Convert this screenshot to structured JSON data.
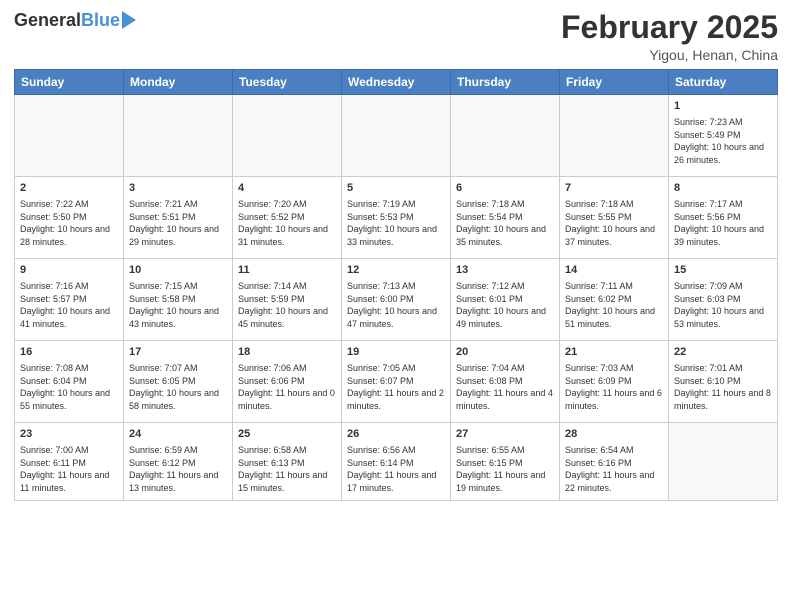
{
  "header": {
    "logo_general": "General",
    "logo_blue": "Blue",
    "month_title": "February 2025",
    "location": "Yigou, Henan, China"
  },
  "days_of_week": [
    "Sunday",
    "Monday",
    "Tuesday",
    "Wednesday",
    "Thursday",
    "Friday",
    "Saturday"
  ],
  "weeks": [
    [
      {
        "day": "",
        "info": ""
      },
      {
        "day": "",
        "info": ""
      },
      {
        "day": "",
        "info": ""
      },
      {
        "day": "",
        "info": ""
      },
      {
        "day": "",
        "info": ""
      },
      {
        "day": "",
        "info": ""
      },
      {
        "day": "1",
        "info": "Sunrise: 7:23 AM\nSunset: 5:49 PM\nDaylight: 10 hours and 26 minutes."
      }
    ],
    [
      {
        "day": "2",
        "info": "Sunrise: 7:22 AM\nSunset: 5:50 PM\nDaylight: 10 hours and 28 minutes."
      },
      {
        "day": "3",
        "info": "Sunrise: 7:21 AM\nSunset: 5:51 PM\nDaylight: 10 hours and 29 minutes."
      },
      {
        "day": "4",
        "info": "Sunrise: 7:20 AM\nSunset: 5:52 PM\nDaylight: 10 hours and 31 minutes."
      },
      {
        "day": "5",
        "info": "Sunrise: 7:19 AM\nSunset: 5:53 PM\nDaylight: 10 hours and 33 minutes."
      },
      {
        "day": "6",
        "info": "Sunrise: 7:18 AM\nSunset: 5:54 PM\nDaylight: 10 hours and 35 minutes."
      },
      {
        "day": "7",
        "info": "Sunrise: 7:18 AM\nSunset: 5:55 PM\nDaylight: 10 hours and 37 minutes."
      },
      {
        "day": "8",
        "info": "Sunrise: 7:17 AM\nSunset: 5:56 PM\nDaylight: 10 hours and 39 minutes."
      }
    ],
    [
      {
        "day": "9",
        "info": "Sunrise: 7:16 AM\nSunset: 5:57 PM\nDaylight: 10 hours and 41 minutes."
      },
      {
        "day": "10",
        "info": "Sunrise: 7:15 AM\nSunset: 5:58 PM\nDaylight: 10 hours and 43 minutes."
      },
      {
        "day": "11",
        "info": "Sunrise: 7:14 AM\nSunset: 5:59 PM\nDaylight: 10 hours and 45 minutes."
      },
      {
        "day": "12",
        "info": "Sunrise: 7:13 AM\nSunset: 6:00 PM\nDaylight: 10 hours and 47 minutes."
      },
      {
        "day": "13",
        "info": "Sunrise: 7:12 AM\nSunset: 6:01 PM\nDaylight: 10 hours and 49 minutes."
      },
      {
        "day": "14",
        "info": "Sunrise: 7:11 AM\nSunset: 6:02 PM\nDaylight: 10 hours and 51 minutes."
      },
      {
        "day": "15",
        "info": "Sunrise: 7:09 AM\nSunset: 6:03 PM\nDaylight: 10 hours and 53 minutes."
      }
    ],
    [
      {
        "day": "16",
        "info": "Sunrise: 7:08 AM\nSunset: 6:04 PM\nDaylight: 10 hours and 55 minutes."
      },
      {
        "day": "17",
        "info": "Sunrise: 7:07 AM\nSunset: 6:05 PM\nDaylight: 10 hours and 58 minutes."
      },
      {
        "day": "18",
        "info": "Sunrise: 7:06 AM\nSunset: 6:06 PM\nDaylight: 11 hours and 0 minutes."
      },
      {
        "day": "19",
        "info": "Sunrise: 7:05 AM\nSunset: 6:07 PM\nDaylight: 11 hours and 2 minutes."
      },
      {
        "day": "20",
        "info": "Sunrise: 7:04 AM\nSunset: 6:08 PM\nDaylight: 11 hours and 4 minutes."
      },
      {
        "day": "21",
        "info": "Sunrise: 7:03 AM\nSunset: 6:09 PM\nDaylight: 11 hours and 6 minutes."
      },
      {
        "day": "22",
        "info": "Sunrise: 7:01 AM\nSunset: 6:10 PM\nDaylight: 11 hours and 8 minutes."
      }
    ],
    [
      {
        "day": "23",
        "info": "Sunrise: 7:00 AM\nSunset: 6:11 PM\nDaylight: 11 hours and 11 minutes."
      },
      {
        "day": "24",
        "info": "Sunrise: 6:59 AM\nSunset: 6:12 PM\nDaylight: 11 hours and 13 minutes."
      },
      {
        "day": "25",
        "info": "Sunrise: 6:58 AM\nSunset: 6:13 PM\nDaylight: 11 hours and 15 minutes."
      },
      {
        "day": "26",
        "info": "Sunrise: 6:56 AM\nSunset: 6:14 PM\nDaylight: 11 hours and 17 minutes."
      },
      {
        "day": "27",
        "info": "Sunrise: 6:55 AM\nSunset: 6:15 PM\nDaylight: 11 hours and 19 minutes."
      },
      {
        "day": "28",
        "info": "Sunrise: 6:54 AM\nSunset: 6:16 PM\nDaylight: 11 hours and 22 minutes."
      },
      {
        "day": "",
        "info": ""
      }
    ]
  ]
}
